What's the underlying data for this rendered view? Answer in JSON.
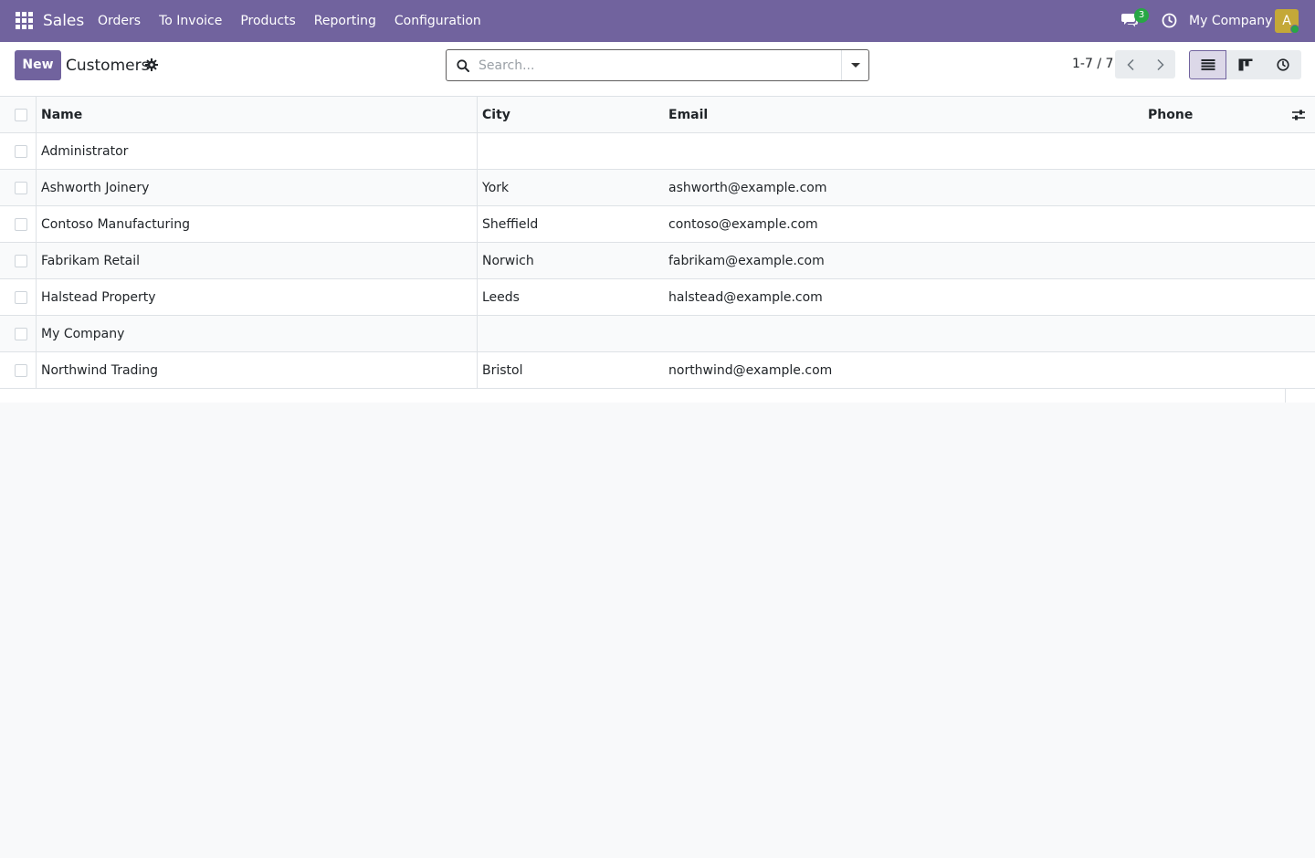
{
  "navbar": {
    "app_name": "Sales",
    "menu": [
      {
        "label": "Orders"
      },
      {
        "label": "To Invoice"
      },
      {
        "label": "Products"
      },
      {
        "label": "Reporting"
      },
      {
        "label": "Configuration"
      }
    ],
    "messages_badge": "3",
    "company": "My Company",
    "avatar_letter": "A",
    "brand_color": "#71639e"
  },
  "control_panel": {
    "new_label": "New",
    "title": "Customers",
    "search_placeholder": "Search...",
    "pager": "1-7 / 7",
    "views": [
      "list",
      "kanban",
      "activity"
    ],
    "active_view": "list"
  },
  "table": {
    "columns": [
      "Name",
      "City",
      "Email",
      "Phone"
    ],
    "rows": [
      {
        "name": "Administrator",
        "city": "",
        "email": "",
        "phone": ""
      },
      {
        "name": "Ashworth Joinery",
        "city": "York",
        "email": "ashworth@example.com",
        "phone": ""
      },
      {
        "name": "Contoso Manufacturing",
        "city": "Sheffield",
        "email": "contoso@example.com",
        "phone": ""
      },
      {
        "name": "Fabrikam Retail",
        "city": "Norwich",
        "email": "fabrikam@example.com",
        "phone": ""
      },
      {
        "name": "Halstead Property",
        "city": "Leeds",
        "email": "halstead@example.com",
        "phone": ""
      },
      {
        "name": "My Company",
        "city": "",
        "email": "",
        "phone": ""
      },
      {
        "name": "Northwind Trading",
        "city": "Bristol",
        "email": "northwind@example.com",
        "phone": ""
      }
    ]
  }
}
